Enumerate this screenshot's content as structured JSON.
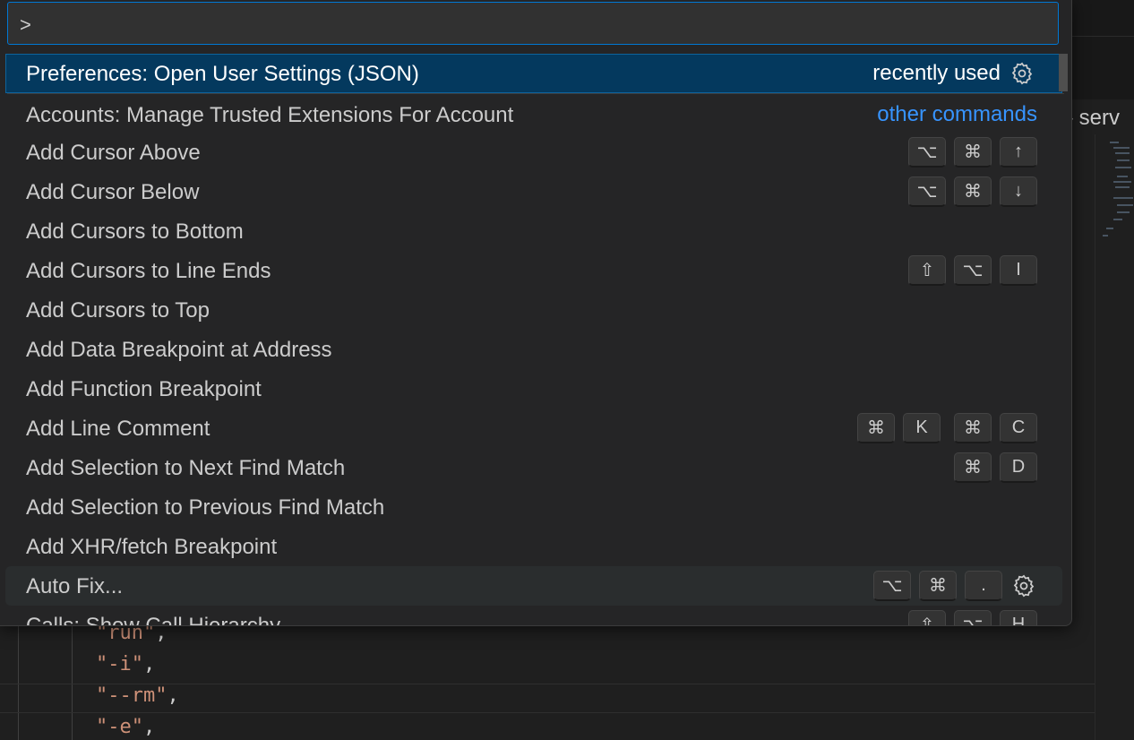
{
  "command_palette": {
    "input_value": ">",
    "items": [
      {
        "label": "Preferences: Open User Settings (JSON)",
        "description": "recently used",
        "keys": [],
        "gear": true
      },
      {
        "label": "Accounts: Manage Trusted Extensions For Account",
        "description": "other commands",
        "keys": []
      },
      {
        "label": "Add Cursor Above",
        "keys": [
          "⌥",
          "⌘",
          "↑"
        ]
      },
      {
        "label": "Add Cursor Below",
        "keys": [
          "⌥",
          "⌘",
          "↓"
        ]
      },
      {
        "label": "Add Cursors to Bottom",
        "keys": []
      },
      {
        "label": "Add Cursors to Line Ends",
        "keys": [
          "⇧",
          "⌥",
          "I"
        ]
      },
      {
        "label": "Add Cursors to Top",
        "keys": []
      },
      {
        "label": "Add Data Breakpoint at Address",
        "keys": []
      },
      {
        "label": "Add Function Breakpoint",
        "keys": []
      },
      {
        "label": "Add Line Comment",
        "keys": [
          "⌘",
          "K",
          "⌘",
          "C"
        ]
      },
      {
        "label": "Add Selection to Next Find Match",
        "keys": [
          "⌘",
          "D"
        ]
      },
      {
        "label": "Add Selection to Previous Find Match",
        "keys": []
      },
      {
        "label": "Add XHR/fetch Breakpoint",
        "keys": []
      },
      {
        "label": "Auto Fix...",
        "keys": [
          "⌥",
          "⌘",
          "."
        ],
        "gear": true
      },
      {
        "label": "Calls: Show Call Hierarchy",
        "keys": [
          "⇧",
          "⌥",
          "H"
        ]
      }
    ]
  },
  "editor": {
    "breadcrumb_fragment": "} serv",
    "code_lines": [
      "\"run\"",
      "\"-i\"",
      "\"--rm\"",
      "\"-e\""
    ]
  },
  "colors": {
    "selection": "#04395e",
    "accent_link": "#3794ff",
    "string": "#ce9178",
    "focus_border": "#0078d4"
  }
}
